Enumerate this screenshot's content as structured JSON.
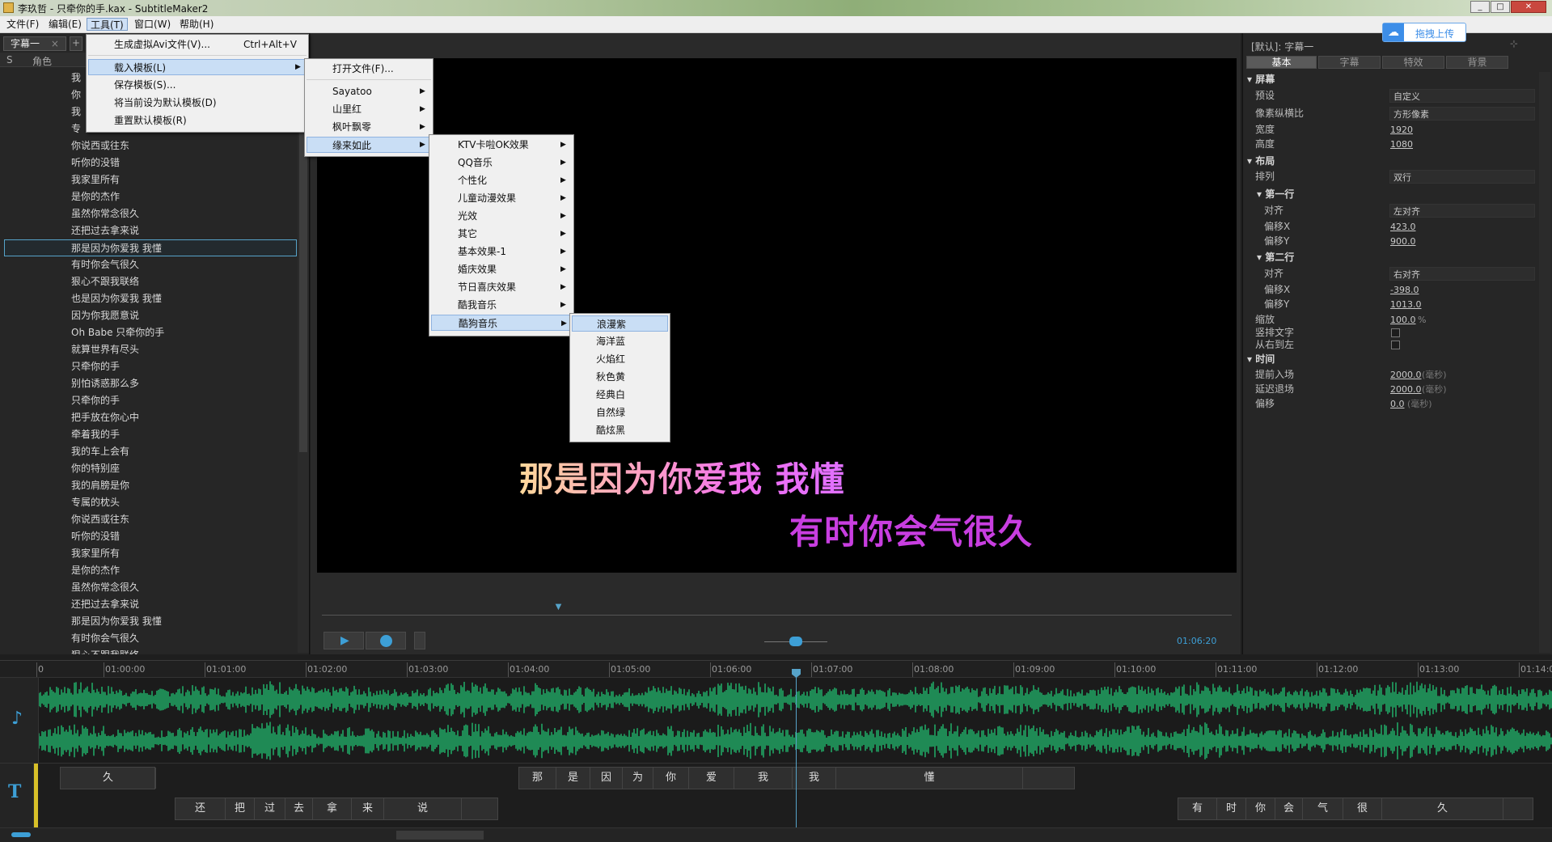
{
  "window": {
    "title": "李玖哲 - 只牵你的手.kax - SubtitleMaker2"
  },
  "menubar": {
    "items": [
      "文件(F)",
      "编辑(E)",
      "工具(T)",
      "窗口(W)",
      "帮助(H)"
    ]
  },
  "left_panel": {
    "tab": "字幕一",
    "columns": [
      "S",
      "角色"
    ],
    "lines": [
      "我",
      "你",
      "我",
      "专",
      "你说西或往东",
      "听你的没错",
      "我家里所有",
      "是你的杰作",
      "虽然你常念很久",
      "还把过去拿来说",
      "那是因为你爱我  我懂",
      "有时你会气很久",
      "狠心不跟我联络",
      "也是因为你爱我  我懂",
      "因为你我愿意说",
      "Oh Babe 只牵你的手",
      "就算世界有尽头",
      "只牵你的手",
      "别怕诱惑那么多",
      "只牵你的手",
      "把手放在你心中",
      "牵着我的手",
      "我的车上会有",
      "你的特别座",
      "我的肩膀是你",
      "专属的枕头",
      "你说西或往东",
      "听你的没错",
      "我家里所有",
      "是你的杰作",
      "虽然你常念很久",
      "还把过去拿来说",
      "那是因为你爱我  我懂",
      "有时你会气很久",
      "狠心不跟我联络"
    ],
    "selected_index": 10
  },
  "tools_menu": {
    "items": [
      {
        "label": "生成虚拟Avi文件(V)...",
        "shortcut": "Ctrl+Alt+V"
      },
      {
        "label": "载入模板(L)",
        "submenu": true
      },
      {
        "label": "保存模板(S)..."
      },
      {
        "label": "将当前设为默认模板(D)"
      },
      {
        "label": "重置默认模板(R)"
      }
    ]
  },
  "load_template_menu": {
    "items": [
      "打开文件(F)...",
      "Sayatoo",
      "山里红",
      "枫叶飘零",
      "缘来如此"
    ]
  },
  "yuanlai_menu": {
    "items": [
      "KTV卡啦OK效果",
      "QQ音乐",
      "个性化",
      "儿童动漫效果",
      "光效",
      "其它",
      "基本效果-1",
      "婚庆效果",
      "节日喜庆效果",
      "酷我音乐",
      "酷狗音乐"
    ]
  },
  "kugou_menu": {
    "items": [
      "浪漫紫",
      "海洋蓝",
      "火焰红",
      "秋色黄",
      "经典白",
      "自然绿",
      "酷炫黑"
    ]
  },
  "preview": {
    "line1": "那是因为你爱我 我懂",
    "line2": "有时你会气很久",
    "time": "01:06:20",
    "progress_fraction": 0.26
  },
  "upload_button": {
    "label": "拖拽上传"
  },
  "right_panel": {
    "header": "[默认]: 字幕一",
    "tabs": [
      "基本",
      "字幕",
      "特效",
      "背景"
    ],
    "screen_section": "屏幕",
    "layout_section": "布局",
    "line1_section": "第一行",
    "line2_section": "第二行",
    "time_section": "时间",
    "props": {
      "preset": {
        "label": "预设",
        "value": "自定义"
      },
      "pixel_ratio": {
        "label": "像素纵横比",
        "value": "方形像素"
      },
      "width": {
        "label": "宽度",
        "value": "1920"
      },
      "height": {
        "label": "高度",
        "value": "1080"
      },
      "arrange": {
        "label": "排列",
        "value": "双行"
      },
      "l1_align": {
        "label": "对齐",
        "value": "左对齐"
      },
      "l1_offx": {
        "label": "偏移X",
        "value": "423.0"
      },
      "l1_offy": {
        "label": "偏移Y",
        "value": "900.0"
      },
      "l2_align": {
        "label": "对齐",
        "value": "右对齐"
      },
      "l2_offx": {
        "label": "偏移X",
        "value": "-398.0"
      },
      "l2_offy": {
        "label": "偏移Y",
        "value": "1013.0"
      },
      "scale": {
        "label": "缩放",
        "value": "100.0",
        "unit": "%"
      },
      "vertical": {
        "label": "竖排文字"
      },
      "rtl": {
        "label": "从右到左"
      },
      "advance": {
        "label": "提前入场",
        "value": "2000.0",
        "unit": "(毫秒)"
      },
      "delay": {
        "label": "延迟退场",
        "value": "2000.0",
        "unit": "(毫秒)"
      },
      "offset": {
        "label": "偏移",
        "value": "0.0",
        "unit": "(毫秒)"
      }
    }
  },
  "timeline": {
    "ruler_labels": [
      "0",
      "01:00:00",
      "01:01:00",
      "01:02:00",
      "01:03:00",
      "01:04:00",
      "01:05:00",
      "01:06:00",
      "01:07:00",
      "01:08:00",
      "01:09:00",
      "01:10:00",
      "01:11:00",
      "01:12:00",
      "01:13:00",
      "01:14:0"
    ],
    "track1_blocks": [
      {
        "chars": [
          "久"
        ]
      },
      {
        "chars": [
          "那",
          "是",
          "因",
          "为",
          "你",
          "爱",
          "我",
          "我",
          "懂"
        ]
      }
    ],
    "track2_blocks": [
      {
        "chars": [
          "还",
          "把",
          "过",
          "去",
          "拿",
          "来",
          "说"
        ]
      },
      {
        "chars": [
          "有",
          "时",
          "你",
          "会",
          "气",
          "很",
          "久"
        ]
      }
    ]
  },
  "colors": {
    "accent": "#56a3c9",
    "wave": "#1f8a55",
    "subtitle_purple": "#c83ee0"
  }
}
